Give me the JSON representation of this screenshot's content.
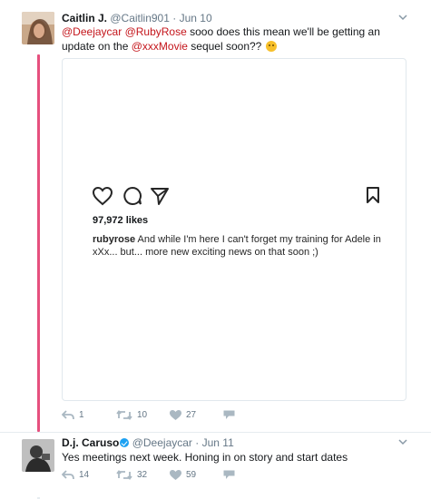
{
  "tweets": [
    {
      "name": "Caitlin J.",
      "handle": "@Caitlin901",
      "date": "Jun 10",
      "text_parts": {
        "m1": "@Deejaycar",
        "m2": "@RubyRose",
        "t1": " sooo does this mean we'll be getting an update on the ",
        "m3": "@xxxMovie",
        "t2": " sequel soon?? "
      },
      "emoji": "sweat-smile-emoji",
      "media": {
        "likes": "97,972 likes",
        "caption_user": "rubyrose",
        "caption_text": " And while I'm here I can't forget my training for Adele in xXx... but... more new exciting news on that soon ;)"
      },
      "actions": {
        "reply": "1",
        "retweet": "10",
        "like": "27"
      }
    },
    {
      "name": "D.j. Caruso",
      "handle": "@Deejaycar",
      "date": "Jun 11",
      "text": "Yes meetings next week.  Honing in on story and start dates",
      "actions": {
        "reply": "14",
        "retweet": "32",
        "like": "59"
      }
    }
  ],
  "separator": "·",
  "icons": {
    "reply": "reply-icon",
    "retweet": "retweet-icon",
    "like": "heart-icon",
    "dm": "direct-message-icon",
    "chevron": "chevron-down-icon",
    "verified": "verified-badge-icon"
  },
  "colors": {
    "mention": "#c4151b",
    "thread_line": "#e0245e",
    "muted": "#657786",
    "verified": "#1da1f2"
  }
}
